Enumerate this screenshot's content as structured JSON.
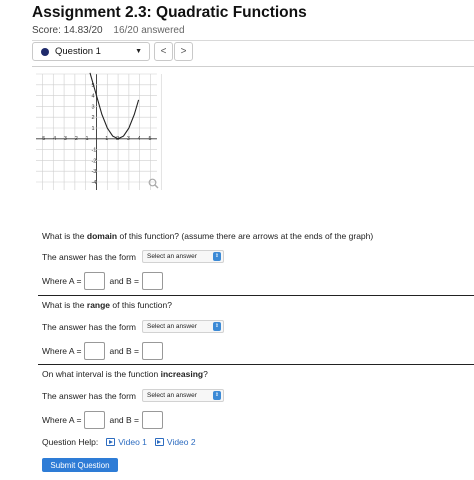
{
  "header": {
    "title": "Assignment 2.3: Quadratic Functions",
    "score": "Score: 14.83/20",
    "answered": "16/20 answered"
  },
  "question_nav": {
    "selected": "Question 1",
    "prev_label": "<",
    "next_label": ">"
  },
  "graph": {
    "x_ticks": [
      "-5",
      "-4",
      "-3",
      "-2",
      "-1",
      "1",
      "2",
      "3",
      "4",
      "5"
    ],
    "y_ticks": [
      "5",
      "4",
      "3",
      "2",
      "1",
      "-1",
      "-2",
      "-3",
      "-4",
      "-5"
    ]
  },
  "chart_data": {
    "type": "line",
    "title": "",
    "xlabel": "",
    "ylabel": "",
    "xlim": [
      -5,
      5
    ],
    "ylim": [
      -5,
      5
    ],
    "grid": true,
    "series": [
      {
        "x": [
          -0.6,
          0,
          0.5,
          1,
          1.5,
          2,
          2.5,
          3,
          3.5,
          3.9
        ],
        "y": [
          6.1,
          4,
          2.25,
          0.999,
          0.251,
          0,
          0.25,
          1,
          2.25,
          3.6
        ]
      }
    ]
  },
  "questions": [
    {
      "prompt_pre": "What is the ",
      "prompt_bold": "domain",
      "prompt_post": " of this function? (assume there are arrows at the ends of the graph)",
      "form_label": "The answer has the form",
      "select_value": "Select an answer",
      "where_a": "Where A =",
      "and_b": "and B ="
    },
    {
      "prompt_pre": "What is the ",
      "prompt_bold": "range",
      "prompt_post": " of this function?",
      "form_label": "The answer has the form",
      "select_value": "Select an answer",
      "where_a": "Where A =",
      "and_b": "and B ="
    },
    {
      "prompt_pre": "On what interval is the function ",
      "prompt_bold": "increasing",
      "prompt_post": "?",
      "form_label": "The answer has the form",
      "select_value": "Select an answer",
      "where_a": "Where A =",
      "and_b": "and B ="
    }
  ],
  "help": {
    "label": "Question Help:",
    "video1": "Video 1",
    "video2": "Video 2"
  },
  "submit_label": "Submit Question"
}
